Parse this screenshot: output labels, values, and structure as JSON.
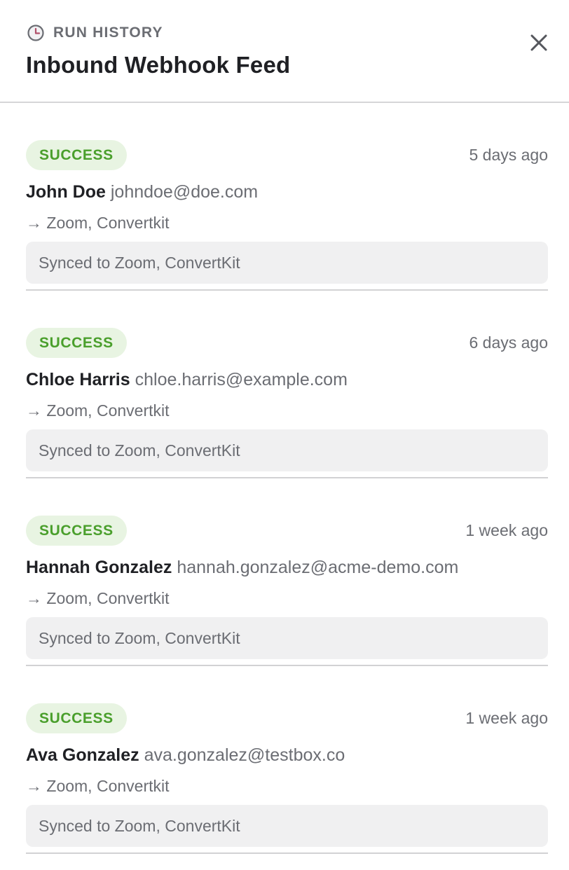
{
  "header": {
    "eyebrow": "RUN HISTORY",
    "eyebrow_icon": "clock-icon",
    "title": "Inbound Webhook Feed",
    "close_icon": "close-icon"
  },
  "colors": {
    "success_text": "#4a9f2c",
    "success_bg": "#e8f4e2",
    "muted_text": "#6b6d73",
    "result_bg": "#f0f0f1"
  },
  "runs": [
    {
      "status": "SUCCESS",
      "time": "5 days ago",
      "name": "John Doe",
      "email": "johndoe@doe.com",
      "destinations": "→ Zoom, Convertkit",
      "result": "Synced to Zoom, ConvertKit"
    },
    {
      "status": "SUCCESS",
      "time": "6 days ago",
      "name": "Chloe Harris",
      "email": "chloe.harris@example.com",
      "destinations": "→ Zoom, Convertkit",
      "result": "Synced to Zoom, ConvertKit"
    },
    {
      "status": "SUCCESS",
      "time": "1 week ago",
      "name": "Hannah Gonzalez",
      "email": "hannah.gonzalez@acme-demo.com",
      "destinations": "→ Zoom, Convertkit",
      "result": "Synced to Zoom, ConvertKit"
    },
    {
      "status": "SUCCESS",
      "time": "1 week ago",
      "name": "Ava Gonzalez",
      "email": "ava.gonzalez@testbox.co",
      "destinations": "→ Zoom, Convertkit",
      "result": "Synced to Zoom, ConvertKit"
    }
  ]
}
